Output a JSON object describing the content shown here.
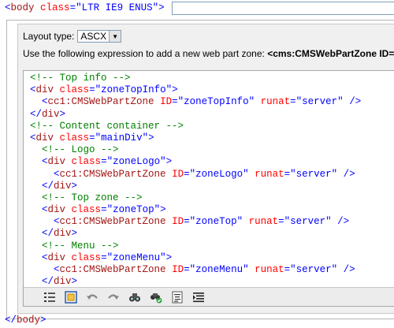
{
  "top_line": {
    "open": "<",
    "tag": "body",
    "attr": "class",
    "eq": "=",
    "value": "\"LTR IE9 ENUS\"",
    "close": ">"
  },
  "layout": {
    "label": "Layout type:",
    "selected": "ASCX"
  },
  "instruction": {
    "text": "Use the following expression to add a new web part zone: ",
    "expression": "<cms:CMSWebPartZone ID="
  },
  "code_lines": [
    [
      {
        "t": "c",
        "v": "<!-- Top info -->"
      }
    ],
    [
      {
        "t": "p",
        "v": "<"
      },
      {
        "t": "n",
        "v": "div"
      },
      {
        "t": "p",
        "v": " "
      },
      {
        "t": "a",
        "v": "class"
      },
      {
        "t": "p",
        "v": "="
      },
      {
        "t": "s",
        "v": "\"zoneTopInfo\""
      },
      {
        "t": "p",
        "v": ">"
      }
    ],
    [
      {
        "t": "p",
        "v": "  <"
      },
      {
        "t": "n",
        "v": "cc1:CMSWebPartZone"
      },
      {
        "t": "p",
        "v": " "
      },
      {
        "t": "a",
        "v": "ID"
      },
      {
        "t": "p",
        "v": "="
      },
      {
        "t": "s",
        "v": "\"zoneTopInfo\""
      },
      {
        "t": "p",
        "v": " "
      },
      {
        "t": "a",
        "v": "runat"
      },
      {
        "t": "p",
        "v": "="
      },
      {
        "t": "s",
        "v": "\"server\""
      },
      {
        "t": "p",
        "v": " />"
      }
    ],
    [
      {
        "t": "p",
        "v": "</"
      },
      {
        "t": "n",
        "v": "div"
      },
      {
        "t": "p",
        "v": ">"
      }
    ],
    [
      {
        "t": "c",
        "v": "<!-- Content container -->"
      }
    ],
    [
      {
        "t": "p",
        "v": "<"
      },
      {
        "t": "n",
        "v": "div"
      },
      {
        "t": "p",
        "v": " "
      },
      {
        "t": "a",
        "v": "class"
      },
      {
        "t": "p",
        "v": "="
      },
      {
        "t": "s",
        "v": "\"mainDiv\""
      },
      {
        "t": "p",
        "v": ">"
      }
    ],
    [
      {
        "t": "p",
        "v": "  "
      },
      {
        "t": "c",
        "v": "<!-- Logo -->"
      }
    ],
    [
      {
        "t": "p",
        "v": "  <"
      },
      {
        "t": "n",
        "v": "div"
      },
      {
        "t": "p",
        "v": " "
      },
      {
        "t": "a",
        "v": "class"
      },
      {
        "t": "p",
        "v": "="
      },
      {
        "t": "s",
        "v": "\"zoneLogo\""
      },
      {
        "t": "p",
        "v": ">"
      }
    ],
    [
      {
        "t": "p",
        "v": "    <"
      },
      {
        "t": "n",
        "v": "cc1:CMSWebPartZone"
      },
      {
        "t": "p",
        "v": " "
      },
      {
        "t": "a",
        "v": "ID"
      },
      {
        "t": "p",
        "v": "="
      },
      {
        "t": "s",
        "v": "\"zoneLogo\""
      },
      {
        "t": "p",
        "v": " "
      },
      {
        "t": "a",
        "v": "runat"
      },
      {
        "t": "p",
        "v": "="
      },
      {
        "t": "s",
        "v": "\"server\""
      },
      {
        "t": "p",
        "v": " />"
      }
    ],
    [
      {
        "t": "p",
        "v": "  </"
      },
      {
        "t": "n",
        "v": "div"
      },
      {
        "t": "p",
        "v": ">"
      }
    ],
    [
      {
        "t": "p",
        "v": "  "
      },
      {
        "t": "c",
        "v": "<!-- Top zone -->"
      }
    ],
    [
      {
        "t": "p",
        "v": "  <"
      },
      {
        "t": "n",
        "v": "div"
      },
      {
        "t": "p",
        "v": " "
      },
      {
        "t": "a",
        "v": "class"
      },
      {
        "t": "p",
        "v": "="
      },
      {
        "t": "s",
        "v": "\"zoneTop\""
      },
      {
        "t": "p",
        "v": ">"
      }
    ],
    [
      {
        "t": "p",
        "v": "    <"
      },
      {
        "t": "n",
        "v": "cc1:CMSWebPartZone"
      },
      {
        "t": "p",
        "v": " "
      },
      {
        "t": "a",
        "v": "ID"
      },
      {
        "t": "p",
        "v": "="
      },
      {
        "t": "s",
        "v": "\"zoneTop\""
      },
      {
        "t": "p",
        "v": " "
      },
      {
        "t": "a",
        "v": "runat"
      },
      {
        "t": "p",
        "v": "="
      },
      {
        "t": "s",
        "v": "\"server\""
      },
      {
        "t": "p",
        "v": " />"
      }
    ],
    [
      {
        "t": "p",
        "v": "  </"
      },
      {
        "t": "n",
        "v": "div"
      },
      {
        "t": "p",
        "v": ">"
      }
    ],
    [
      {
        "t": "p",
        "v": "  "
      },
      {
        "t": "c",
        "v": "<!-- Menu -->"
      }
    ],
    [
      {
        "t": "p",
        "v": "  <"
      },
      {
        "t": "n",
        "v": "div"
      },
      {
        "t": "p",
        "v": " "
      },
      {
        "t": "a",
        "v": "class"
      },
      {
        "t": "p",
        "v": "="
      },
      {
        "t": "s",
        "v": "\"zoneMenu\""
      },
      {
        "t": "p",
        "v": ">"
      }
    ],
    [
      {
        "t": "p",
        "v": "    <"
      },
      {
        "t": "n",
        "v": "cc1:CMSWebPartZone"
      },
      {
        "t": "p",
        "v": " "
      },
      {
        "t": "a",
        "v": "ID"
      },
      {
        "t": "p",
        "v": "="
      },
      {
        "t": "s",
        "v": "\"zoneMenu\""
      },
      {
        "t": "p",
        "v": " "
      },
      {
        "t": "a",
        "v": "runat"
      },
      {
        "t": "p",
        "v": "="
      },
      {
        "t": "s",
        "v": "\"server\""
      },
      {
        "t": "p",
        "v": " />"
      }
    ],
    [
      {
        "t": "p",
        "v": "  </"
      },
      {
        "t": "n",
        "v": "div"
      },
      {
        "t": "p",
        "v": ">"
      }
    ]
  ],
  "toolbar": {
    "icons": [
      "list-numbered-icon",
      "select-all-icon",
      "undo-icon",
      "redo-icon",
      "find-icon",
      "replace-icon",
      "format-icon",
      "indent-icon"
    ]
  },
  "bottom_line": {
    "open": "</",
    "tag": "body",
    "close": ">"
  },
  "colors": {
    "comment": "#008000",
    "tag_punct": "#0000ff",
    "tag_name": "#a31515",
    "attribute": "#ff0000",
    "string": "#0000ff"
  }
}
